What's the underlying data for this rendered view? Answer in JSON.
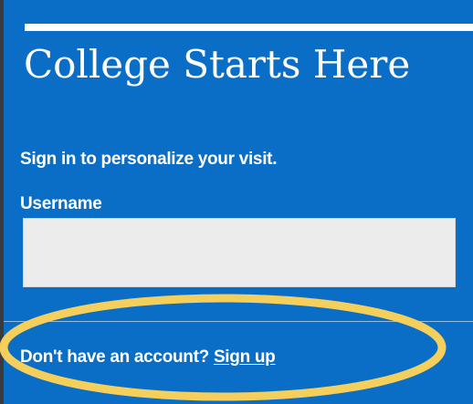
{
  "header": {
    "title": "College Starts Here"
  },
  "form": {
    "subtitle": "Sign in to personalize your visit.",
    "username_label": "Username",
    "username_value": "",
    "username_placeholder": ""
  },
  "footer": {
    "prompt": "Don't have an account?",
    "signup_label": "Sign up"
  },
  "colors": {
    "panel_bg": "#0a6ec6",
    "page_bg": "#3a3a3a",
    "highlight": "#f5cf5b"
  }
}
